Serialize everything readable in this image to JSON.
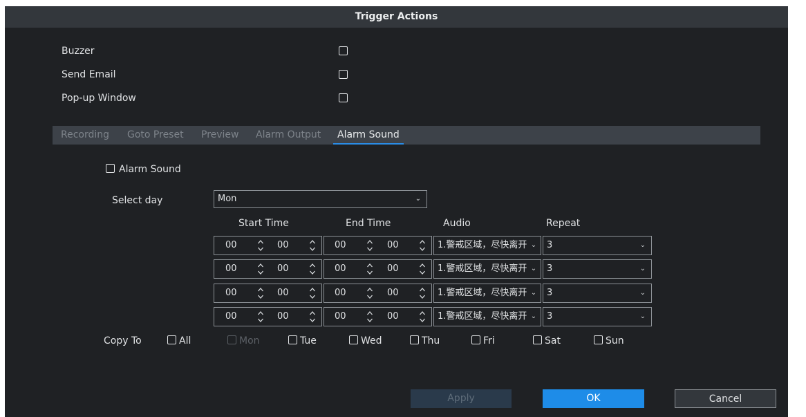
{
  "dialog": {
    "title": "Trigger Actions"
  },
  "options": [
    {
      "label": "Buzzer",
      "checked": false
    },
    {
      "label": "Send Email",
      "checked": false
    },
    {
      "label": "Pop-up Window",
      "checked": false
    }
  ],
  "tabs": [
    {
      "label": "Recording",
      "active": false
    },
    {
      "label": "Goto Preset",
      "active": false
    },
    {
      "label": "Preview",
      "active": false
    },
    {
      "label": "Alarm Output",
      "active": false
    },
    {
      "label": "Alarm Sound",
      "active": true
    }
  ],
  "alarm_sound": {
    "enable_label": "Alarm Sound",
    "enabled": false,
    "select_day_label": "Select day",
    "select_day_value": "Mon",
    "columns": {
      "start": "Start Time",
      "end": "End Time",
      "audio": "Audio",
      "repeat": "Repeat"
    },
    "rows": [
      {
        "start_h": "00",
        "start_m": "00",
        "end_h": "00",
        "end_m": "00",
        "audio": "1.警戒区域，尽快离开",
        "repeat": "3"
      },
      {
        "start_h": "00",
        "start_m": "00",
        "end_h": "00",
        "end_m": "00",
        "audio": "1.警戒区域，尽快离开",
        "repeat": "3"
      },
      {
        "start_h": "00",
        "start_m": "00",
        "end_h": "00",
        "end_m": "00",
        "audio": "1.警戒区域，尽快离开",
        "repeat": "3"
      },
      {
        "start_h": "00",
        "start_m": "00",
        "end_h": "00",
        "end_m": "00",
        "audio": "1.警戒区域，尽快离开",
        "repeat": "3"
      }
    ]
  },
  "copy_to": {
    "label": "Copy To",
    "days": [
      {
        "label": "All",
        "enabled": true,
        "checked": false
      },
      {
        "label": "Mon",
        "enabled": false,
        "checked": false
      },
      {
        "label": "Tue",
        "enabled": true,
        "checked": false
      },
      {
        "label": "Wed",
        "enabled": true,
        "checked": false
      },
      {
        "label": "Thu",
        "enabled": true,
        "checked": false
      },
      {
        "label": "Fri",
        "enabled": true,
        "checked": false
      },
      {
        "label": "Sat",
        "enabled": true,
        "checked": false
      },
      {
        "label": "Sun",
        "enabled": true,
        "checked": false
      }
    ]
  },
  "buttons": {
    "apply": "Apply",
    "ok": "OK",
    "cancel": "Cancel"
  },
  "colors": {
    "dialog_bg": "#1f2124",
    "title_bg": "#33373c",
    "tab_bar": "#3d4249",
    "accent": "#2a8ce6",
    "apply_disabled": "#2a3a4b"
  },
  "icons": {
    "checkbox": "checkbox-icon",
    "dropdown": "chevron-down-icon",
    "spinner": "up-down-spinner-icon"
  }
}
